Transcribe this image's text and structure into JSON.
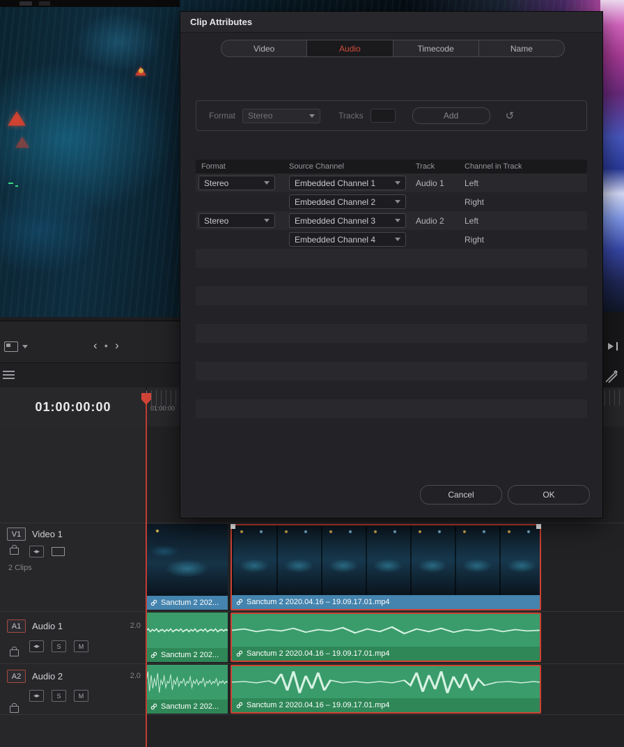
{
  "dialog": {
    "title": "Clip Attributes",
    "tabs": {
      "video": "Video",
      "audio": "Audio",
      "timecode": "Timecode",
      "name": "Name"
    },
    "add_section": {
      "format_label": "Format",
      "format_value": "Stereo",
      "tracks_label": "Tracks",
      "tracks_value": "",
      "add_label": "Add",
      "reset_icon": "↺"
    },
    "table": {
      "headers": {
        "format": "Format",
        "source": "Source Channel",
        "track": "Track",
        "channel": "Channel in Track"
      },
      "rows": [
        {
          "format": "Stereo",
          "source": "Embedded Channel 1",
          "track": "Audio 1",
          "channel": "Left"
        },
        {
          "format": "",
          "source": "Embedded Channel 2",
          "track": "",
          "channel": "Right"
        },
        {
          "format": "Stereo",
          "source": "Embedded Channel 3",
          "track": "Audio 2",
          "channel": "Left"
        },
        {
          "format": "",
          "source": "Embedded Channel 4",
          "track": "",
          "channel": "Right"
        }
      ]
    },
    "buttons": {
      "cancel": "Cancel",
      "ok": "OK"
    }
  },
  "timeline": {
    "timecode": "01:00:00:00",
    "ruler_label": "01:00:00",
    "video_track": {
      "badge": "V1",
      "name": "Video 1",
      "info": "2 Clips"
    },
    "audio_tracks": [
      {
        "badge": "A1",
        "name": "Audio 1",
        "channels": "2.0"
      },
      {
        "badge": "A2",
        "name": "Audio 2",
        "channels": "2.0"
      }
    ],
    "clip_short_label": "Sanctum 2 202...",
    "clip_long_label": "Sanctum 2 2020.04.16 – 19.09.17.01.mp4",
    "solo_label": "S",
    "mute_label": "M"
  },
  "transport": {
    "prev": "‹",
    "stop": "●",
    "next": "›"
  },
  "colors": {
    "accent_red": "#cf4b38",
    "selection_red": "#cf4232",
    "video_clip_blue": "#4484ae",
    "audio_clip_green": "#3a9c6b",
    "playhead_red": "#d04437"
  }
}
